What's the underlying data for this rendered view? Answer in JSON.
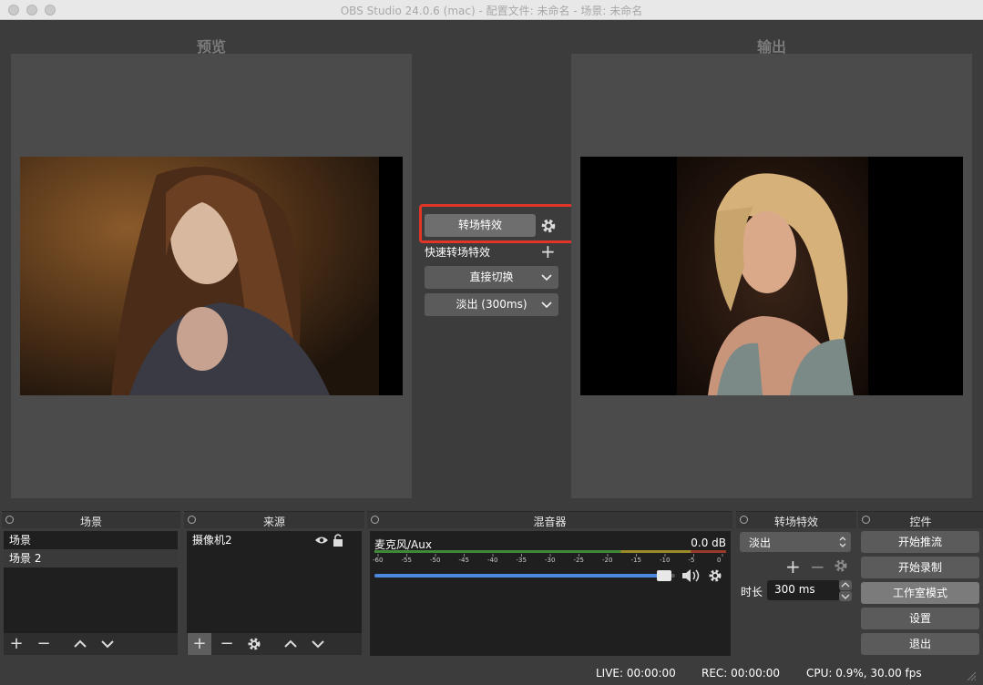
{
  "window": {
    "title": "OBS Studio 24.0.6 (mac) - 配置文件: 未命名 - 场景: 未命名"
  },
  "preview": {
    "title": "预览"
  },
  "program": {
    "title": "输出"
  },
  "transition_area": {
    "button_label": "转场特效",
    "quick_label": "快速转场特效",
    "quick_items": [
      "直接切换",
      "淡出 (300ms)"
    ]
  },
  "docks": {
    "scenes": {
      "title": "场景",
      "items": [
        "场景",
        "场景 2"
      ]
    },
    "sources": {
      "title": "来源",
      "items": [
        "摄像机2"
      ]
    },
    "mixer": {
      "title": "混音器",
      "channel": "麦克风/Aux",
      "level": "0.0 dB",
      "ticks": [
        "-60",
        "-55",
        "-50",
        "-45",
        "-40",
        "-35",
        "-30",
        "-25",
        "-20",
        "-15",
        "-10",
        "-5",
        "0"
      ],
      "volume": 0.97
    },
    "transitions": {
      "title": "转场特效",
      "selected": "淡出",
      "duration_label": "时长",
      "duration_value": "300 ms"
    },
    "controls": {
      "title": "控件",
      "buttons": [
        "开始推流",
        "开始录制",
        "工作室模式",
        "设置",
        "退出"
      ]
    }
  },
  "status": {
    "live": "LIVE: 00:00:00",
    "rec": "REC: 00:00:00",
    "cpu": "CPU: 0.9%, 30.00 fps"
  }
}
